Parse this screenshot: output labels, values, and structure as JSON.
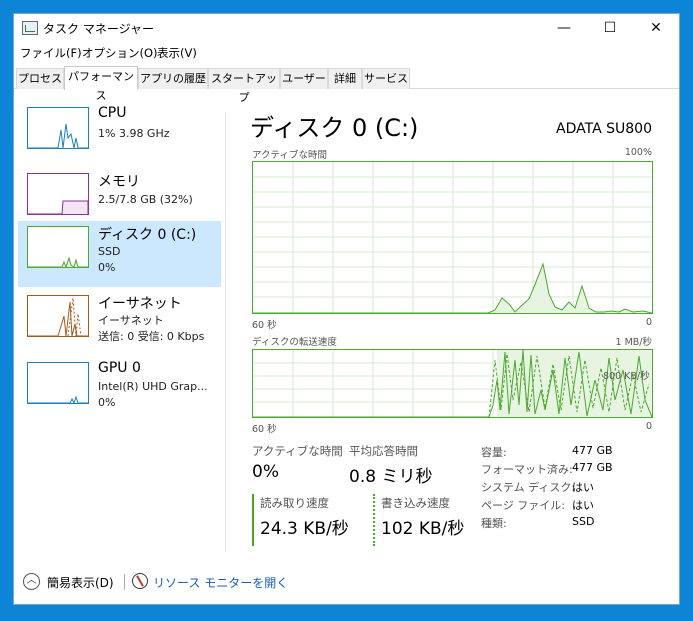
{
  "window": {
    "title": "タスク マネージャー",
    "minimize": "—",
    "maximize": "☐",
    "close": "✕"
  },
  "menu": [
    "ファイル(F)",
    "オプション(O)",
    "表示(V)"
  ],
  "tabs": [
    {
      "label": "プロセス"
    },
    {
      "label": "パフォーマンス",
      "active": true
    },
    {
      "label": "アプリの履歴"
    },
    {
      "label": "スタートアップ"
    },
    {
      "label": "ユーザー"
    },
    {
      "label": "詳細"
    },
    {
      "label": "サービス"
    }
  ],
  "sidebar": [
    {
      "title": "CPU",
      "sub1": "1%  3.98 GHz",
      "sub2": "",
      "color": "#1a7fc0",
      "icon": "cpu-graph-icon"
    },
    {
      "title": "メモリ",
      "sub1": "2.5/7.8 GB (32%)",
      "sub2": "",
      "color": "#8e2e9e",
      "icon": "memory-graph-icon"
    },
    {
      "title": "ディスク 0 (C:)",
      "sub1": "SSD",
      "sub2": "0%",
      "color": "#4ca82e",
      "icon": "disk-graph-icon",
      "selected": true
    },
    {
      "title": "イーサネット",
      "sub1": "イーサネット",
      "sub2": "送信: 0 受信: 0 Kbps",
      "color": "#a45a1c",
      "icon": "ethernet-graph-icon"
    },
    {
      "title": "GPU 0",
      "sub1": "Intel(R) UHD Grap...",
      "sub2": "0%",
      "color": "#1a7fc0",
      "icon": "gpu-graph-icon"
    }
  ],
  "main": {
    "title": "ディスク 0 (C:)",
    "model": "ADATA SU800"
  },
  "chart1": {
    "label": "アクティブな時間",
    "max": "100%",
    "time": "60 秒",
    "min": "0"
  },
  "chart2": {
    "label": "ディスクの転送速度",
    "max": "1 MB/秒",
    "time": "60 秒",
    "min": "0",
    "inner": "800 KB/秒"
  },
  "stats": {
    "active_label": "アクティブな時間",
    "active_value": "0%",
    "resp_label": "平均応答時間",
    "resp_value": "0.8 ミリ秒",
    "read_label": "読み取り速度",
    "read_value": "24.3 KB/秒",
    "write_label": "書き込み速度",
    "write_value": "102 KB/秒"
  },
  "props": [
    {
      "label": "容量:",
      "value": "477 GB"
    },
    {
      "label": "フォーマット済み:",
      "value": "477 GB"
    },
    {
      "label": "システム ディスク:",
      "value": "はい"
    },
    {
      "label": "ページ ファイル:",
      "value": "はい"
    },
    {
      "label": "種類:",
      "value": "SSD"
    }
  ],
  "footer": {
    "collapse": "簡易表示(D)",
    "resmon": "リソース モニターを開く",
    "chevron": "︿"
  },
  "colors": {
    "disk": "#4ca82e",
    "selected_bg": "#cce8ff",
    "link": "#1a5fb4",
    "desktop": "#0d84d6"
  }
}
